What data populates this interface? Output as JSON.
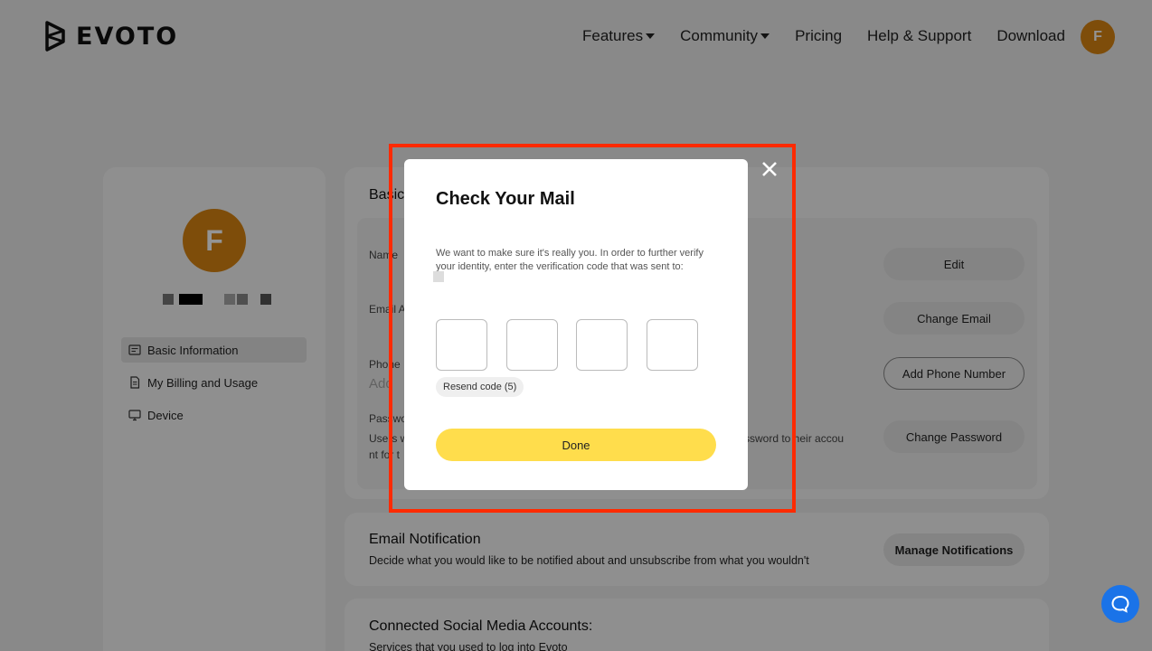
{
  "brand": {
    "name": "EVOTO",
    "accent": "#d98512"
  },
  "nav": {
    "items": [
      {
        "label": "Features",
        "dropdown": true
      },
      {
        "label": "Community",
        "dropdown": true
      },
      {
        "label": "Pricing",
        "dropdown": false
      },
      {
        "label": "Help & Support",
        "dropdown": false
      },
      {
        "label": "Download",
        "dropdown": false
      }
    ],
    "avatar_initial": "F"
  },
  "sidebar": {
    "avatar_initial": "F",
    "items": [
      {
        "label": "Basic Information",
        "icon": "id-card-icon",
        "active": true
      },
      {
        "label": "My Billing and Usage",
        "icon": "document-icon",
        "active": false
      },
      {
        "label": "Device",
        "icon": "monitor-icon",
        "active": false
      }
    ]
  },
  "basic": {
    "title": "Basic",
    "name_label": "Name",
    "email_label": "Email A",
    "phone_label": "Phone",
    "phone_placeholder": "Add",
    "password_label": "Password",
    "password_desc_left": "Users w",
    "password_desc_left2": "nt for t",
    "password_desc_right": "ssword to heir accou",
    "buttons": {
      "edit": "Edit",
      "change_email": "Change Email",
      "add_phone": "Add Phone Number",
      "change_password": "Change Password"
    }
  },
  "email_notification": {
    "title": "Email Notification",
    "desc": "Decide what you would like to be notified about and unsubscribe from what you wouldn't",
    "button": "Manage Notifications"
  },
  "social": {
    "title": "Connected Social Media Accounts:",
    "desc": "Services that you used to log into Evoto"
  },
  "modal": {
    "title": "Check Your Mail",
    "desc": "We want to make sure it's really you. In order to further verify your identity, enter the verification code that was sent to:",
    "code_boxes": [
      "",
      "",
      "",
      ""
    ],
    "resend_label": "Resend code (5)",
    "done_label": "Done",
    "close_icon": "close-icon",
    "highlight_color": "#ff2a00",
    "button_color": "#ffdd4c"
  },
  "chat": {
    "icon": "chat-bubble-icon",
    "color": "#1a73e8"
  }
}
